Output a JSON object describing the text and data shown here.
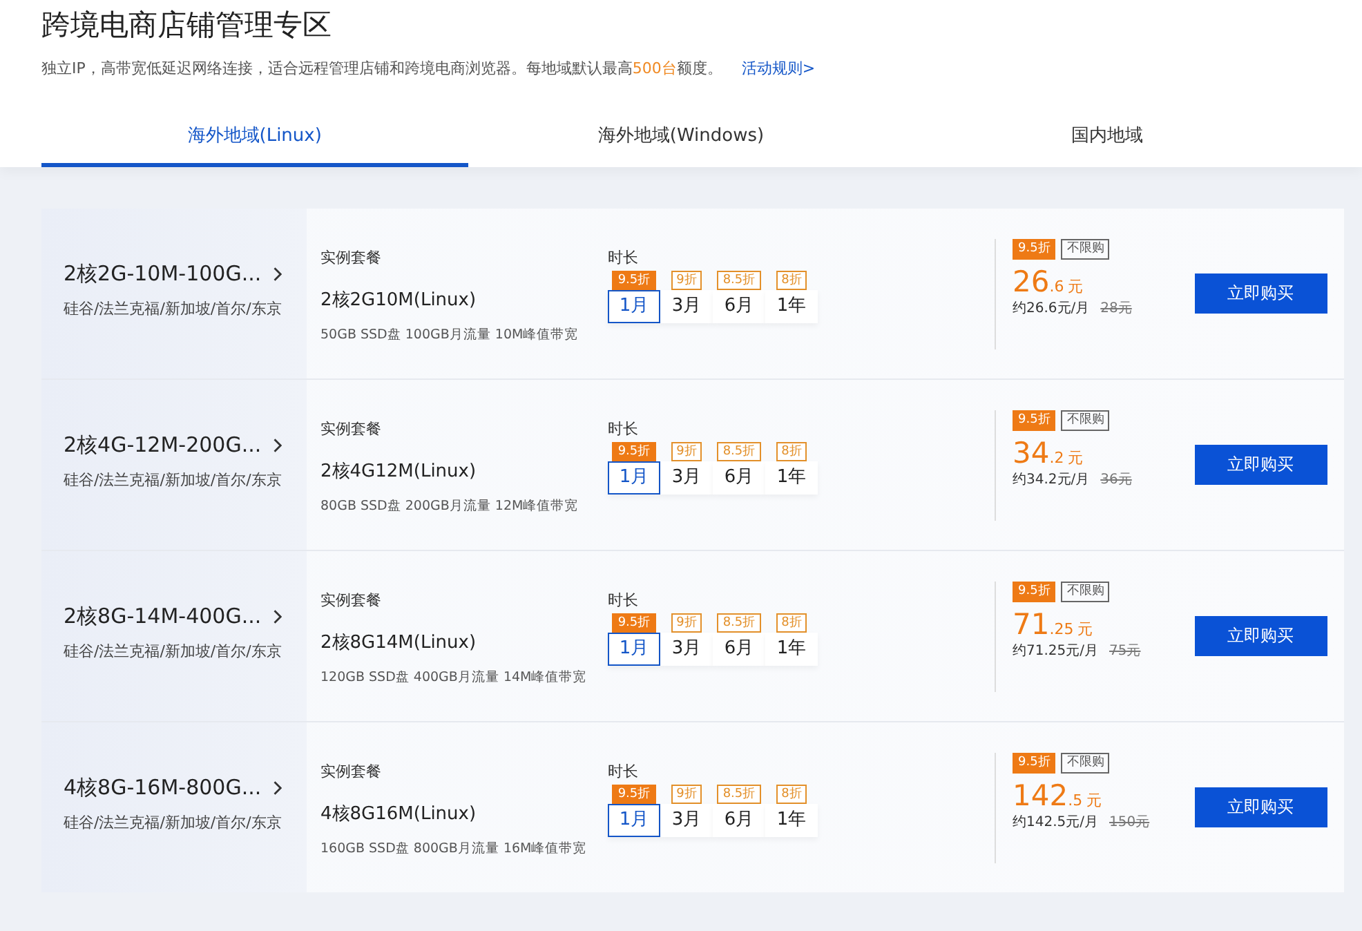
{
  "header": {
    "title": "跨境电商店铺管理专区",
    "description": "独立IP，高带宽低延迟网络连接，适合远程管理店铺和跨境电商浏览器。每地域默认最高**500台**额度。",
    "rules_link": "活动规则>"
  },
  "tabs": [
    {
      "label": "海外地域(Linux)",
      "selected": true
    },
    {
      "label": "海外地域(Windows)",
      "selected": false
    },
    {
      "label": "国内地域",
      "selected": false
    }
  ],
  "products": [
    {
      "name": "2核2G-10M-100G...",
      "regions": "硅谷/法兰克福/新加坡/首尔/东京",
      "package_label": "实例套餐",
      "package": "2核2G10M(Linux)",
      "specs": "50GB SSD盘 100GB月流量 10M峰值带宽",
      "duration_label": "时长",
      "durations": [
        {
          "label": "1月",
          "discount": "9.5折",
          "selected": true
        },
        {
          "label": "3月",
          "discount": "9折",
          "selected": false
        },
        {
          "label": "6月",
          "discount": "8.5折",
          "selected": false
        },
        {
          "label": "1年",
          "discount": "8折",
          "selected": false
        }
      ],
      "tags": [
        {
          "kind": "discount",
          "text": "9.5折"
        },
        {
          "kind": "limit",
          "text": "不限购"
        }
      ],
      "price": {
        "integer": "26",
        "decimal": ".6",
        "unit": "元"
      },
      "monthly": "约26.6元/月",
      "original": "28元",
      "buy": "立即购买"
    },
    {
      "name": "2核4G-12M-200G...",
      "regions": "硅谷/法兰克福/新加坡/首尔/东京",
      "package_label": "实例套餐",
      "package": "2核4G12M(Linux)",
      "specs": "80GB SSD盘 200GB月流量 12M峰值带宽",
      "duration_label": "时长",
      "durations": [
        {
          "label": "1月",
          "discount": "9.5折",
          "selected": true
        },
        {
          "label": "3月",
          "discount": "9折",
          "selected": false
        },
        {
          "label": "6月",
          "discount": "8.5折",
          "selected": false
        },
        {
          "label": "1年",
          "discount": "8折",
          "selected": false
        }
      ],
      "tags": [
        {
          "kind": "discount",
          "text": "9.5折"
        },
        {
          "kind": "limit",
          "text": "不限购"
        }
      ],
      "price": {
        "integer": "34",
        "decimal": ".2",
        "unit": "元"
      },
      "monthly": "约34.2元/月",
      "original": "36元",
      "buy": "立即购买"
    },
    {
      "name": "2核8G-14M-400G...",
      "regions": "硅谷/法兰克福/新加坡/首尔/东京",
      "package_label": "实例套餐",
      "package": "2核8G14M(Linux)",
      "specs": "120GB SSD盘 400GB月流量 14M峰值带宽",
      "duration_label": "时长",
      "durations": [
        {
          "label": "1月",
          "discount": "9.5折",
          "selected": true
        },
        {
          "label": "3月",
          "discount": "9折",
          "selected": false
        },
        {
          "label": "6月",
          "discount": "8.5折",
          "selected": false
        },
        {
          "label": "1年",
          "discount": "8折",
          "selected": false
        }
      ],
      "tags": [
        {
          "kind": "discount",
          "text": "9.5折"
        },
        {
          "kind": "limit",
          "text": "不限购"
        }
      ],
      "price": {
        "integer": "71",
        "decimal": ".25",
        "unit": "元"
      },
      "monthly": "约71.25元/月",
      "original": "75元",
      "buy": "立即购买"
    },
    {
      "name": "4核8G-16M-800G...",
      "regions": "硅谷/法兰克福/新加坡/首尔/东京",
      "package_label": "实例套餐",
      "package": "4核8G16M(Linux)",
      "specs": "160GB SSD盘 800GB月流量 16M峰值带宽",
      "duration_label": "时长",
      "durations": [
        {
          "label": "1月",
          "discount": "9.5折",
          "selected": true
        },
        {
          "label": "3月",
          "discount": "9折",
          "selected": false
        },
        {
          "label": "6月",
          "discount": "8.5折",
          "selected": false
        },
        {
          "label": "1年",
          "discount": "8折",
          "selected": false
        }
      ],
      "tags": [
        {
          "kind": "discount",
          "text": "9.5折"
        },
        {
          "kind": "limit",
          "text": "不限购"
        }
      ],
      "price": {
        "integer": "142",
        "decimal": ".5",
        "unit": "元"
      },
      "monthly": "约142.5元/月",
      "original": "150元",
      "buy": "立即购买"
    }
  ]
}
